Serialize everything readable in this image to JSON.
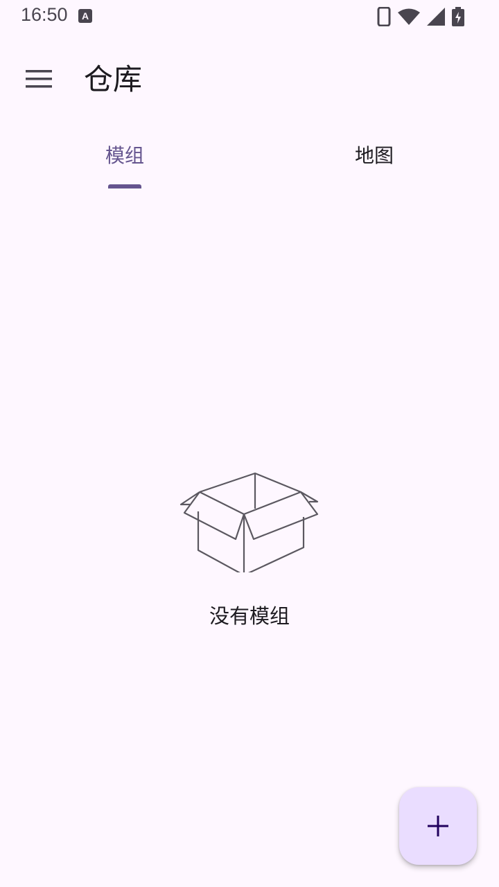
{
  "status_bar": {
    "time": "16:50",
    "notification_icon": "a-icon",
    "icons": [
      "phone-icon",
      "wifi-icon",
      "signal-icon",
      "battery-charging-icon"
    ]
  },
  "top_bar": {
    "menu_icon": "hamburger-menu-icon",
    "title": "仓库"
  },
  "tabs": [
    {
      "label": "模组",
      "selected": true
    },
    {
      "label": "地图",
      "selected": false
    }
  ],
  "empty_state": {
    "icon": "empty-box-icon",
    "text": "没有模组"
  },
  "fab": {
    "icon": "add-icon"
  },
  "colors": {
    "background": "#FEF7FF",
    "primary": "#65558F",
    "on_surface": "#1D1B20",
    "on_surface_variant": "#49454F",
    "fab_container": "#EADDFF",
    "fab_icon": "#21005D"
  }
}
